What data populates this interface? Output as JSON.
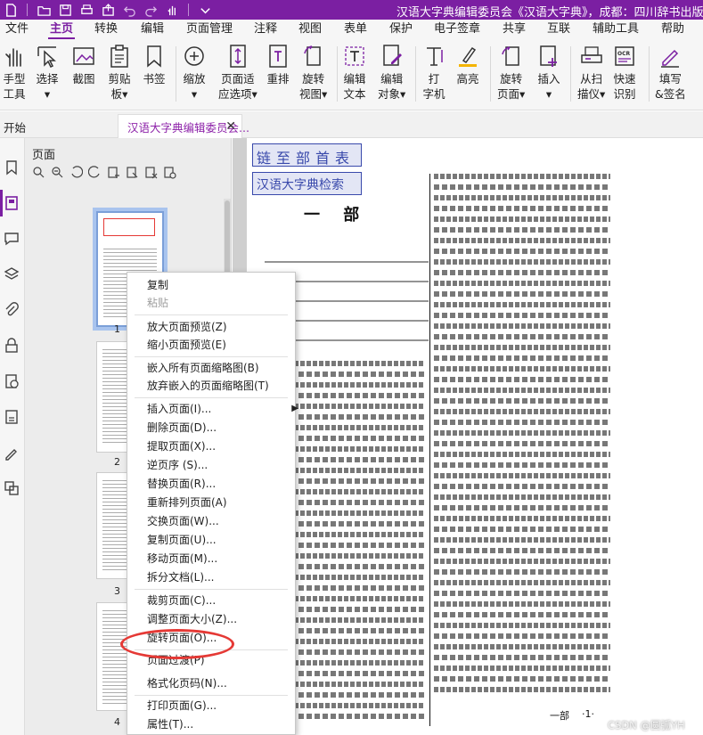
{
  "title_bar": {
    "title": "汉语大字典编辑委员会《汉语大字典》，成都：四川辞书出版社，"
  },
  "menu": {
    "items": [
      "文件",
      "主页",
      "转换",
      "编辑",
      "页面管理",
      "注释",
      "视图",
      "表单",
      "保护",
      "电子签章",
      "共享",
      "互联",
      "辅助工具",
      "帮助"
    ],
    "active": "主页"
  },
  "ribbon": {
    "hand": [
      "手型",
      "工具"
    ],
    "select": [
      "选择",
      "▾"
    ],
    "screenshot": [
      "截图",
      ""
    ],
    "clipboard": [
      "剪贴",
      "板▾"
    ],
    "bookmark": [
      "书签",
      ""
    ],
    "zoom": [
      "缩放",
      "▾"
    ],
    "fit_page": [
      "页面适",
      "应选项▾"
    ],
    "reflow": [
      "重排",
      ""
    ],
    "rotate_view": [
      "旋转",
      "视图▾"
    ],
    "edit_text": [
      "编辑",
      "文本"
    ],
    "edit_object": [
      "编辑",
      "对象▾"
    ],
    "typewriter": [
      "打",
      "字机"
    ],
    "highlight": [
      "高亮",
      ""
    ],
    "rotate_page": [
      "旋转",
      "页面▾"
    ],
    "insert": [
      "插入",
      "▾"
    ],
    "from_scan": [
      "从扫",
      "描仪▾"
    ],
    "quick_ocr": [
      "快速",
      "识别"
    ],
    "fill_sign": [
      "填写",
      "&签名"
    ]
  },
  "tabs": {
    "start": "开始",
    "document": "汉语大字典编辑委员会..."
  },
  "page_panel": {
    "title": "页面",
    "thumbnails": [
      "1",
      "2",
      "3",
      "4"
    ]
  },
  "document": {
    "link_home": "链至部首表",
    "link_search": "汉语大字典检索",
    "section_title": "一 部",
    "footer_left": "一部",
    "footer_right": "·1·"
  },
  "context_menu": {
    "groups": [
      [
        {
          "label": "复制",
          "enabled": true
        },
        {
          "label": "粘贴",
          "enabled": false
        }
      ],
      [
        {
          "label": "放大页面预览(Z)",
          "enabled": true
        },
        {
          "label": "缩小页面预览(E)",
          "enabled": true
        }
      ],
      [
        {
          "label": "嵌入所有页面缩略图(B)",
          "enabled": true
        },
        {
          "label": "放弃嵌入的页面缩略图(T)",
          "enabled": true
        }
      ],
      [
        {
          "label": "插入页面(I)...",
          "enabled": true,
          "submenu": true
        },
        {
          "label": "删除页面(D)...",
          "enabled": true
        },
        {
          "label": "提取页面(X)...",
          "enabled": true
        },
        {
          "label": "逆页序 (S)...",
          "enabled": true
        },
        {
          "label": "替换页面(R)...",
          "enabled": true
        },
        {
          "label": "重新排列页面(A)",
          "enabled": true
        },
        {
          "label": "交换页面(W)...",
          "enabled": true
        },
        {
          "label": "复制页面(U)...",
          "enabled": true
        },
        {
          "label": "移动页面(M)...",
          "enabled": true
        },
        {
          "label": "拆分文档(L)...",
          "enabled": true
        }
      ],
      [
        {
          "label": "裁剪页面(C)...",
          "enabled": true
        },
        {
          "label": "调整页面大小(Z)...",
          "enabled": true
        },
        {
          "label": "旋转页面(O)...",
          "enabled": true
        }
      ],
      [
        {
          "label": "页面过渡(P)",
          "enabled": true
        },
        {
          "label": "格式化页码(N)...",
          "enabled": true
        }
      ],
      [
        {
          "label": "打印页面(G)...",
          "enabled": true
        },
        {
          "label": "属性(T)...",
          "enabled": true
        }
      ]
    ]
  },
  "watermark": "CSDN @圆弧YH",
  "colors": {
    "accent": "#7b1fa2",
    "highlight_circle": "#e53935",
    "link_blue": "#3949ab"
  }
}
